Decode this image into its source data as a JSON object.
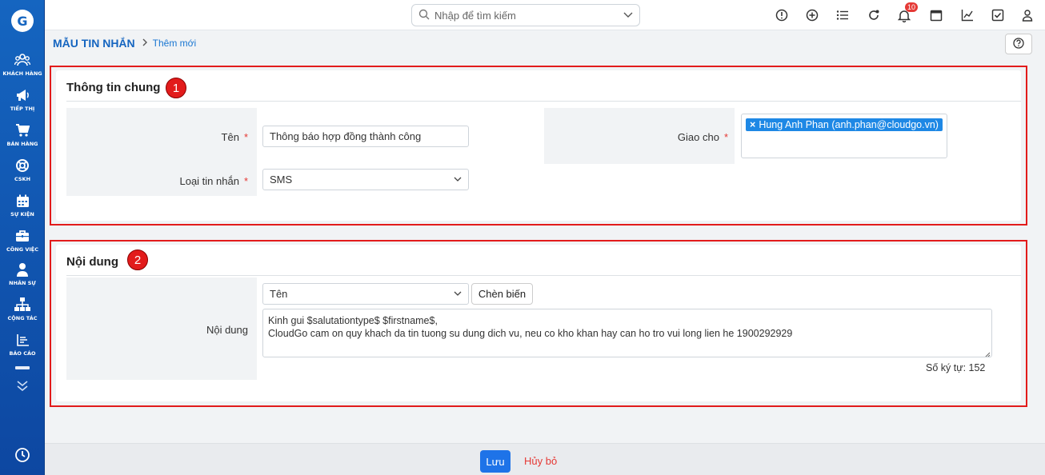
{
  "sidebar": {
    "logo_letter": "G",
    "items": [
      {
        "label": "KHÁCH HÀNG",
        "icon": "users-icon"
      },
      {
        "label": "TIẾP THỊ",
        "icon": "megaphone-icon"
      },
      {
        "label": "BÁN HÀNG",
        "icon": "cart-icon"
      },
      {
        "label": "CSKH",
        "icon": "lifebuoy-icon"
      },
      {
        "label": "SỰ KIỆN",
        "icon": "calendar-icon"
      },
      {
        "label": "CÔNG VIỆC",
        "icon": "briefcase-icon"
      },
      {
        "label": "NHÂN SỰ",
        "icon": "person-icon"
      },
      {
        "label": "CỘNG TÁC",
        "icon": "org-chart-icon"
      },
      {
        "label": "BÁO CÁO",
        "icon": "report-icon"
      }
    ]
  },
  "topbar": {
    "search_placeholder": "Nhập để tìm kiếm",
    "notification_count": "10",
    "icons": [
      "alert-circle-icon",
      "plus-circle-icon",
      "list-icon",
      "refresh-icon",
      "bell-icon",
      "calendar-icon",
      "chart-icon",
      "check-square-icon",
      "user-icon"
    ]
  },
  "breadcrumb": {
    "root": "MẪU TIN NHẮN",
    "current": "Thêm mới"
  },
  "general": {
    "title": "Thông tin chung",
    "marker": "1",
    "name_label": "Tên",
    "name_value": "Thông báo hợp đồng thành công",
    "type_label": "Loại tin nhắn",
    "type_value": "SMS",
    "assign_label": "Giao cho",
    "assign_remove": "×",
    "assign_value": "Hung Anh Phan (anh.phan@cloudgo.vn)",
    "required_mark": "*"
  },
  "content": {
    "title": "Nội dung",
    "marker": "2",
    "label": "Nội dung",
    "variable_select": "Tên",
    "insert_button": "Chèn biến",
    "body": "Kinh gui $salutationtype$ $firstname$,\nCloudGo cam on quy khach da tin tuong su dung dich vu, neu co kho khan hay can ho tro vui long lien he 1900292929",
    "char_count": "Số ký tự: 152"
  },
  "footer": {
    "save_label": "Lưu",
    "cancel_label": "Hủy bỏ"
  },
  "colors": {
    "sidebar": "#1565c0",
    "accent": "#1e73e8",
    "highlight_frame": "#e21b1b",
    "cancel": "#e53935"
  }
}
